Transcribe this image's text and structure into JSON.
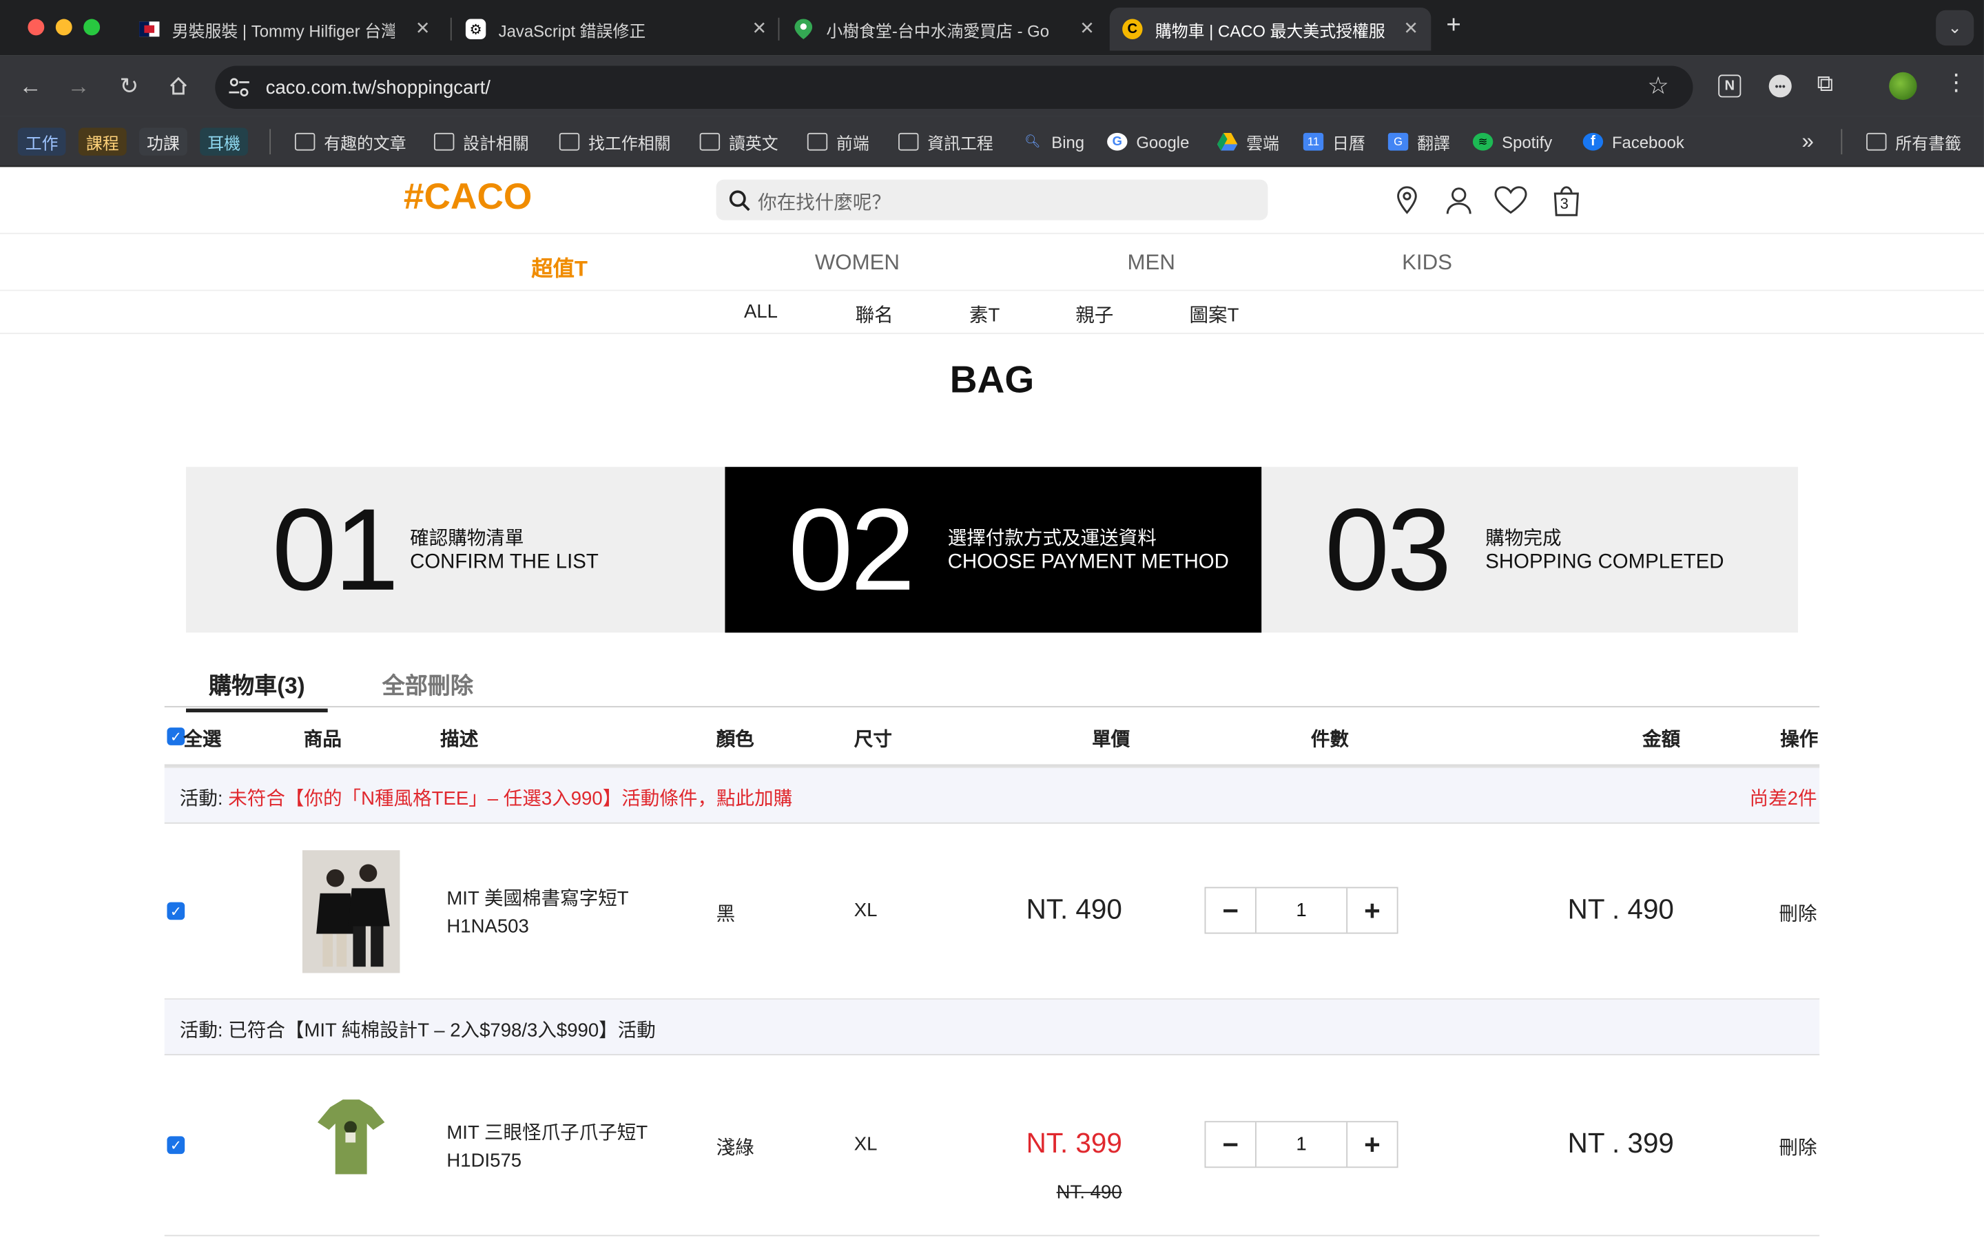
{
  "browser": {
    "tabs": [
      {
        "title": "男裝服裝 | Tommy Hilfiger 台灣",
        "favicon": "tommy-flag-icon"
      },
      {
        "title": "JavaScript 錯誤修正",
        "favicon": "openai-icon"
      },
      {
        "title": "小樹食堂-台中水湳愛買店 - Go",
        "favicon": "maps-pin-icon"
      },
      {
        "title": "購物車 | CACO 最大美式授權服",
        "favicon": "caco-icon"
      }
    ],
    "new_tab": "+",
    "url": "caco.com.tw/shoppingcart/",
    "bookmarks": [
      {
        "label": "工作"
      },
      {
        "label": "課程"
      },
      {
        "label": "功課"
      },
      {
        "label": "耳機"
      },
      {
        "label": "有趣的文章"
      },
      {
        "label": "設計相關"
      },
      {
        "label": "找工作相關"
      },
      {
        "label": "讀英文"
      },
      {
        "label": "前端"
      },
      {
        "label": "資訊工程"
      },
      {
        "label": "Bing"
      },
      {
        "label": "Google"
      },
      {
        "label": "雲端"
      },
      {
        "label": "日曆"
      },
      {
        "label": "翻譯"
      },
      {
        "label": "Spotify"
      },
      {
        "label": "Facebook"
      },
      {
        "label": "所有書籤"
      }
    ],
    "more": "»"
  },
  "site": {
    "logo": "#CACO",
    "search_placeholder": "你在找什麼呢？",
    "cart_count": "3",
    "categories": [
      "超值T",
      "WOMEN",
      "MEN",
      "KIDS"
    ],
    "subcategories": [
      "ALL",
      "聯名",
      "素T",
      "親子",
      "圖案T"
    ],
    "accent": "#f08c00"
  },
  "bag": {
    "title": "BAG",
    "steps": [
      {
        "num": "01",
        "zh": "確認購物清單",
        "en": "CONFIRM THE LIST"
      },
      {
        "num": "02",
        "zh": "選擇付款方式及運送資料",
        "en": "CHOOSE PAYMENT METHOD"
      },
      {
        "num": "03",
        "zh": "購物完成",
        "en": "SHOPPING COMPLETED"
      }
    ],
    "tab_cart": "購物車(3)",
    "tab_delete_all": "全部刪除",
    "headers": [
      "全選",
      "商品",
      "描述",
      "顏色",
      "尺寸",
      "單價",
      "件數",
      "金額",
      "操作"
    ],
    "promos": [
      {
        "label": "活動:",
        "text": "未符合【你的「N種風格TEE」– 任選3入990】活動條件，點此加購",
        "right": "尚差2件"
      },
      {
        "label": "活動:",
        "text": "已符合【MIT 純棉設計T – 2入$798/3入$990】活動"
      }
    ],
    "items": [
      {
        "name": "MIT 美國棉書寫字短T",
        "sku": "H1NA503",
        "color": "黑",
        "size": "XL",
        "price": "NT. 490",
        "qty": "1",
        "total": "NT . 490",
        "action": "刪除"
      },
      {
        "name": "MIT 三眼怪爪子爪子短T",
        "sku": "H1DI575",
        "color": "淺綠",
        "size": "XL",
        "price": "NT. 399",
        "orig_price": "NT. 490",
        "qty": "1",
        "total": "NT . 399",
        "action": "刪除"
      }
    ],
    "sale_color": "#e0282e"
  }
}
